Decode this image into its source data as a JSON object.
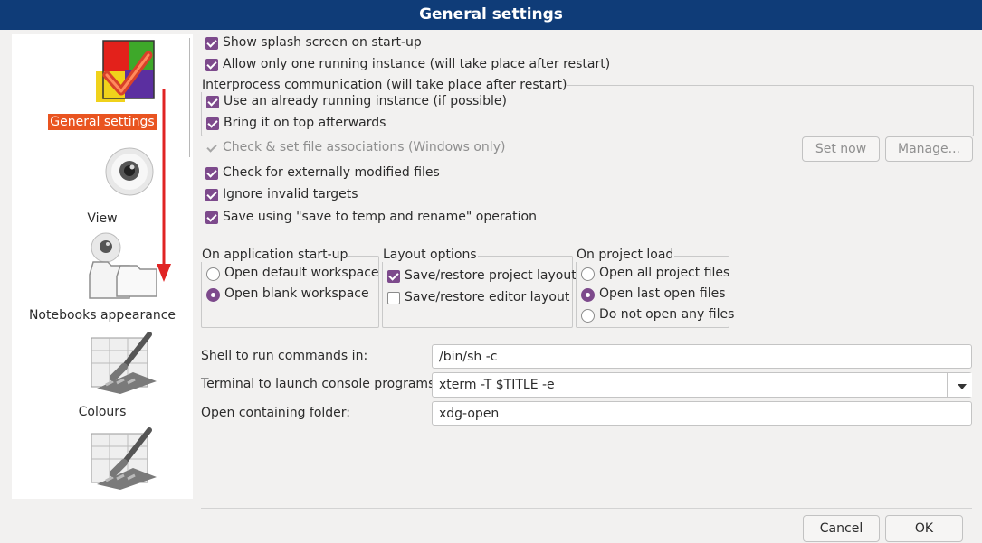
{
  "window": {
    "title": "General settings"
  },
  "sidebar": {
    "items": [
      {
        "label": "General settings",
        "selected": true,
        "icon": "general-settings-icon"
      },
      {
        "label": "View",
        "icon": "view-eye-icon"
      },
      {
        "label": "Notebooks appearance",
        "icon": "notebooks-folders-icon"
      },
      {
        "label": "Colours",
        "icon": "colours-brush-icon"
      },
      {
        "label": "",
        "icon": "brush-palette-icon"
      }
    ]
  },
  "options": {
    "splash": "Show splash screen on start-up",
    "single_instance": "Allow only one running instance (will take place after restart)",
    "ipc_title": "Interprocess communication (will take place after restart)",
    "use_running": "Use an already running instance (if possible)",
    "bring_top": "Bring it on top afterwards",
    "file_assoc": "Check & set file associations (Windows only)",
    "ext_modified": "Check for externally modified files",
    "ignore_invalid": "Ignore invalid targets",
    "save_temp": "Save using \"save to temp and rename\" operation",
    "set_now": "Set now",
    "manage": "Manage..."
  },
  "startup": {
    "title": "On application start-up",
    "open_default": "Open default workspace",
    "open_blank": "Open blank workspace"
  },
  "layout": {
    "title": "Layout options",
    "project_layout": "Save/restore project layout",
    "editor_layout": "Save/restore editor layout"
  },
  "project_load": {
    "title": "On project load",
    "open_all": "Open all project files",
    "open_last": "Open last open files",
    "no_open": "Do not open any files"
  },
  "commands": {
    "shell_label": "Shell to run commands in:",
    "shell_value": "/bin/sh -c",
    "terminal_label": "Terminal to launch console programs:",
    "terminal_value": "xterm -T $TITLE -e",
    "folder_label": "Open containing folder:",
    "folder_value": "xdg-open"
  },
  "buttons": {
    "cancel": "Cancel",
    "ok": "OK"
  },
  "colors": {
    "titlebar": "#0f3c78",
    "selection": "#e95420",
    "check_accent": "#7d4a8c",
    "arrow": "#e02424"
  }
}
